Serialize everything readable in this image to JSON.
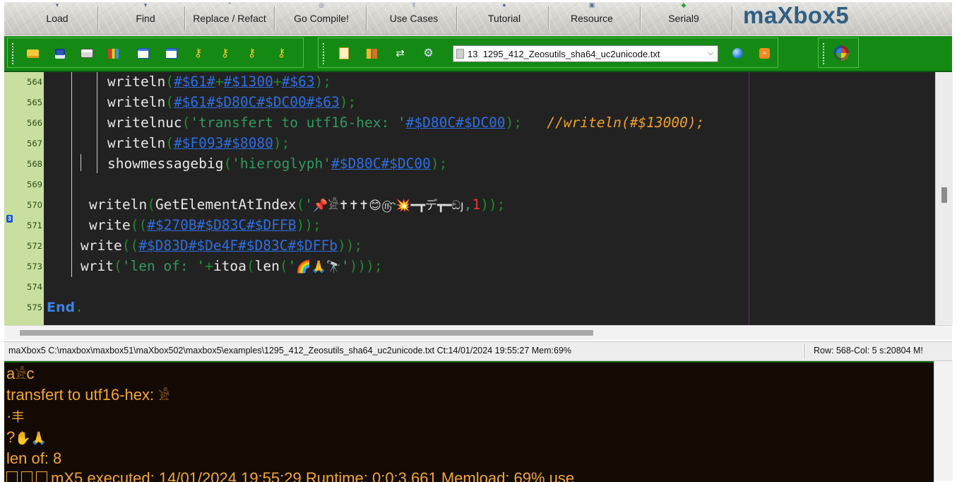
{
  "menu": {
    "buttons": [
      {
        "label": "Load"
      },
      {
        "label": "Find"
      },
      {
        "label": "Replace / Refact"
      },
      {
        "label": "Go Compile!"
      },
      {
        "label": "Use Cases"
      },
      {
        "label": "Tutorial"
      },
      {
        "label": "Resource"
      },
      {
        "label": "Serial9"
      }
    ],
    "brand": "maXbox5"
  },
  "toolbar": {
    "file_select": {
      "index": "13",
      "value": "1295_412_Zeosutils_sha64_uc2unicode.txt"
    },
    "icons": [
      "open-folder-icon",
      "save-icon",
      "print-icon",
      "chart-icon",
      "window-icon",
      "window-alt-icon",
      "key-icon",
      "key-icon",
      "key-icon",
      "key-icon",
      "doc-icon",
      "boxes-icon",
      "arrows-icon",
      "gear-icon",
      "globe-icon",
      "rss-icon",
      "logo-ball-icon"
    ]
  },
  "editor": {
    "line_numbers": [
      "564",
      "565",
      "566",
      "567",
      "568",
      "569",
      "570",
      "571",
      "572",
      "573",
      "574",
      "575"
    ],
    "lines": [
      [
        {
          "t": "fn",
          "v": "writeln"
        },
        {
          "t": "par",
          "v": "("
        },
        {
          "t": "lit",
          "v": "#$61#"
        },
        {
          "t": "par",
          "v": "+"
        },
        {
          "t": "lit",
          "v": "#$1300"
        },
        {
          "t": "par",
          "v": "+"
        },
        {
          "t": "lit",
          "v": "#$63"
        },
        {
          "t": "par",
          "v": ");"
        }
      ],
      [
        {
          "t": "fn",
          "v": "writeln"
        },
        {
          "t": "par",
          "v": "("
        },
        {
          "t": "lit",
          "v": "#$61#$D80C#$DC00#$63"
        },
        {
          "t": "par",
          "v": ");"
        }
      ],
      [
        {
          "t": "fn",
          "v": "writelnuc"
        },
        {
          "t": "par",
          "v": "("
        },
        {
          "t": "str",
          "v": "'transfert to utf16-hex: '"
        },
        {
          "t": "lit",
          "v": "#$D80C#$DC00"
        },
        {
          "t": "par",
          "v": ");   "
        },
        {
          "t": "cmt",
          "v": "//writeln(#$13000);"
        }
      ],
      [
        {
          "t": "fn",
          "v": "writeln"
        },
        {
          "t": "par",
          "v": "("
        },
        {
          "t": "lit",
          "v": "#$F093#$8080"
        },
        {
          "t": "par",
          "v": ");"
        }
      ],
      [
        {
          "t": "fn",
          "v": "showmessagebig"
        },
        {
          "t": "par",
          "v": "("
        },
        {
          "t": "str",
          "v": "'hieroglyph'"
        },
        {
          "t": "lit",
          "v": "#$D80C#$DC00"
        },
        {
          "t": "par",
          "v": ");"
        }
      ],
      [],
      [
        {
          "t": "fn",
          "v": "writeln"
        },
        {
          "t": "par",
          "v": "("
        },
        {
          "t": "fn",
          "v": "GetElementAtIndex"
        },
        {
          "t": "par",
          "v": "("
        },
        {
          "t": "str",
          "v": "'"
        },
        {
          "t": "emo",
          "v": "📌𓀀✝✝✝😊௹💥━┳デ┳━ඞյ"
        },
        {
          "t": "str",
          "v": ","
        },
        {
          "t": "num",
          "v": "1"
        },
        {
          "t": "par",
          "v": "));"
        }
      ],
      [
        {
          "t": "fn",
          "v": "write"
        },
        {
          "t": "par",
          "v": "(("
        },
        {
          "t": "lit",
          "v": "#$270B#$D83C#$DFFB"
        },
        {
          "t": "par",
          "v": "));"
        }
      ],
      [
        {
          "t": "fn",
          "v": "write"
        },
        {
          "t": "par",
          "v": "(("
        },
        {
          "t": "lit",
          "v": "#$D83D#$De4F#$D83C#$DFFb"
        },
        {
          "t": "par",
          "v": "));"
        }
      ],
      [
        {
          "t": "fn",
          "v": "writ"
        },
        {
          "t": "par",
          "v": "("
        },
        {
          "t": "str",
          "v": "'len of: '"
        },
        {
          "t": "par",
          "v": "+"
        },
        {
          "t": "fn",
          "v": "itoa"
        },
        {
          "t": "par",
          "v": "("
        },
        {
          "t": "fn",
          "v": "len"
        },
        {
          "t": "par",
          "v": "("
        },
        {
          "t": "str",
          "v": "'"
        },
        {
          "t": "emo",
          "v": "🌈🙏🔭"
        },
        {
          "t": "str",
          "v": "'"
        },
        {
          "t": "par",
          "v": ")));"
        }
      ],
      [],
      [
        {
          "t": "kw",
          "v": "End"
        },
        {
          "t": "dot",
          "v": "."
        }
      ]
    ]
  },
  "status": {
    "path": "maXbox5 C:\\maxbox\\maxbox51\\maXbox502\\maxbox5\\examples\\1295_412_Zeosutils_sha64_uc2unicode.txt Ct:14/01/2024 19:55:27 Mem:69%",
    "position": "Row:  568-Col:  5 s:20804  M!"
  },
  "output": {
    "lines": [
      {
        "text": "a",
        "glyph": "𓀀",
        "tail": "c"
      },
      {
        "text": "transfert to utf16-hex: ",
        "glyph": "𓀀",
        "tail": ""
      },
      {
        "text": "·",
        "glyph": "丰",
        "tail": ""
      },
      {
        "text": "?",
        "glyph": "✋🙏",
        "tail": ""
      },
      {
        "text": "len of: 8",
        "glyph": "",
        "tail": ""
      },
      {
        "text": "mX5 executed: 14/01/2024 19:55:29  Runtime: 0:0:3.661  Memload: 69% use",
        "glyph": "",
        "tail": ""
      }
    ]
  },
  "colors": {
    "toolbar_green": "#148a14",
    "gutter_green": "#c8dfa0",
    "editor_bg": "#222222",
    "console_bg": "#140a04",
    "console_text": "#f0a73a",
    "brand_blue": "#2f5f83"
  }
}
